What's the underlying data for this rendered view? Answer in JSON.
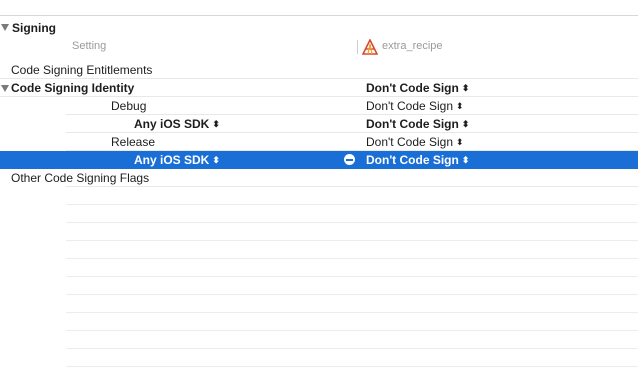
{
  "section": {
    "title": "Signing"
  },
  "columns": {
    "setting": "Setting",
    "target": "extra_recipe"
  },
  "rows": {
    "entitlements": {
      "label": "Code Signing Entitlements"
    },
    "identity": {
      "label": "Code Signing Identity",
      "value": "Don't Code Sign"
    },
    "debug": {
      "label": "Debug",
      "value": "Don't Code Sign"
    },
    "debug_sdk": {
      "label": "Any iOS SDK",
      "value": "Don't Code Sign"
    },
    "release": {
      "label": "Release",
      "value": "Don't Code Sign"
    },
    "release_sdk": {
      "label": "Any iOS SDK",
      "value": "Don't Code Sign"
    },
    "other_flags": {
      "label": "Other Code Signing Flags"
    }
  },
  "colors": {
    "selection": "#1a6fd6",
    "separator": "#e8e8e8"
  },
  "icons": {
    "disclosure": "disclosure-triangle-icon",
    "target": "xcode-target-icon",
    "remove": "minus-circle-icon",
    "stepper": "updown-chevron-icon"
  }
}
